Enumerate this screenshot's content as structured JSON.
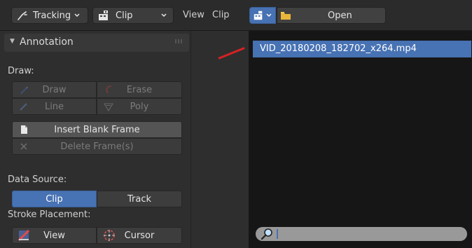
{
  "header": {
    "mode_label": "Tracking",
    "view_type_label": "Clip",
    "menu_view": "View",
    "menu_clip": "Clip",
    "open_label": "Open"
  },
  "annotation_panel": {
    "title": "Annotation",
    "draw_label": "Draw:",
    "tools": {
      "draw": "Draw",
      "erase": "Erase",
      "line": "Line",
      "poly": "Poly"
    },
    "insert_blank_frame": "Insert Blank Frame",
    "delete_frame": "Delete Frame(s)",
    "data_source_label": "Data Source:",
    "data_source": {
      "clip": "Clip",
      "track": "Track",
      "selected": "clip"
    },
    "stroke_placement_label": "Stroke Placement:",
    "stroke_placement": {
      "view": "View",
      "cursor": "Cursor"
    }
  },
  "file_browser": {
    "files": [
      "VID_20180208_182702_x264.mp4"
    ],
    "selected_file": "VID_20180208_182702_x264.mp4",
    "search_value": ""
  },
  "colors": {
    "accent": "#4772b3",
    "annotation_mark": "#d62222"
  }
}
